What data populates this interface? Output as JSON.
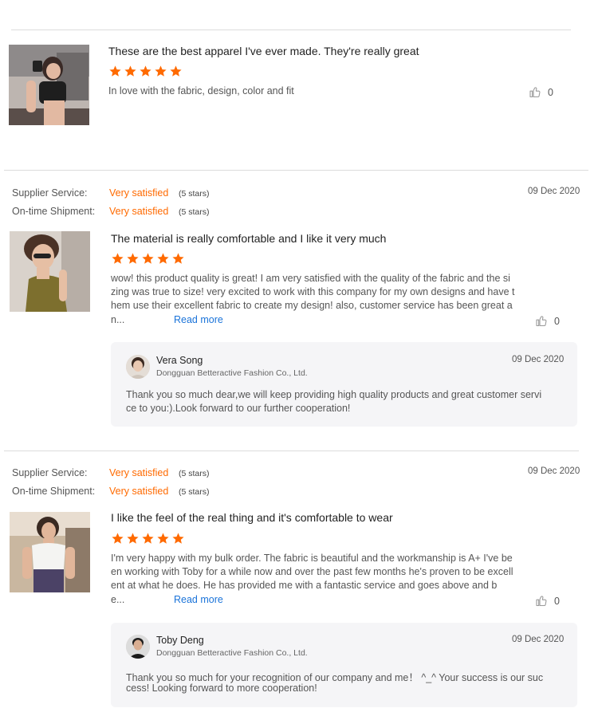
{
  "colors": {
    "accent": "#ff6a00",
    "link": "#1a73d9",
    "reply_bg": "#f5f5f7"
  },
  "reviews": [
    {
      "title": "These are the best  apparel  I've ever made. They're really great",
      "rating": 5,
      "comment": "In love with the fabric, design,  color and fit",
      "likes": "0",
      "photo_icon": "review-photo"
    },
    {
      "supplier_service_label": "Supplier Service:",
      "supplier_service_value": "Very satisfied",
      "supplier_service_stars": "(5 stars)",
      "shipment_label": "On-time Shipment:",
      "shipment_value": "Very satisfied",
      "shipment_stars": "(5 stars)",
      "date": "09 Dec 2020",
      "title": "The material is really comfortable and I like it very much",
      "rating": 5,
      "body_lines": [
        "wow! this product quality is great! I am very satisfied with the quality of the fabric and the si",
        "zing was true to size! very excited to work with this company for my own designs and have t",
        "hem use their excellent fabric to create my design! also, customer service has been great a",
        "n..."
      ],
      "read_more": "Read more",
      "likes": "0",
      "reply": {
        "name": "Vera Song",
        "company": "Dongguan Betteractive Fashion Co., Ltd.",
        "date": "09 Dec 2020",
        "lines": [
          "Thank you so much dear,we will keep providing high quality products and great customer servi",
          "ce to you:).Look forward to our further cooperation!"
        ]
      }
    },
    {
      "supplier_service_label": "Supplier Service:",
      "supplier_service_value": "Very satisfied",
      "supplier_service_stars": "(5 stars)",
      "shipment_label": "On-time Shipment:",
      "shipment_value": "Very satisfied",
      "shipment_stars": "(5 stars)",
      "date": "09 Dec 2020",
      "title": "I like the feel of the real thing and it's comfortable to wear",
      "rating": 5,
      "body_lines": [
        "I'm very happy with my bulk order. The fabric is beautiful and the workmanship is A+ I've be",
        "en working with Toby for a while now and over the past few months he's proven to be excell",
        "ent at what he does. He has provided me with a fantastic service and goes above and b",
        "e..."
      ],
      "read_more": "Read more",
      "likes": "0",
      "reply": {
        "name": "Toby Deng",
        "company": "Dongguan Betteractive Fashion Co., Ltd.",
        "date": "09 Dec 2020",
        "lines": [
          "Thank you so much for your recognition of our company and me！ ^_^ Your success is our suc",
          "cess! Looking forward to more cooperation!"
        ]
      }
    }
  ]
}
